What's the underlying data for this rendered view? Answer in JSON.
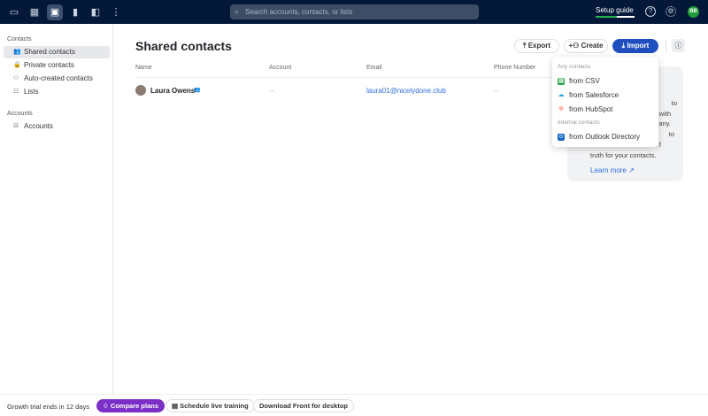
{
  "topbar": {
    "search_placeholder": "Search accounts, contacts, or lists",
    "setup_guide": "Setup guide",
    "setup_progress": 0.55,
    "avatar_initials": "BB"
  },
  "sidebar": {
    "contacts_header": "Contacts",
    "items": [
      {
        "label": "Shared contacts"
      },
      {
        "label": "Private contacts"
      },
      {
        "label": "Auto-created contacts"
      },
      {
        "label": "Lists"
      }
    ],
    "accounts_header": "Accounts",
    "accounts_item": "Accounts"
  },
  "main": {
    "title": "Shared contacts",
    "export": "Export",
    "create": "Create",
    "import": "Import",
    "columns": [
      "Name",
      "Account",
      "Email",
      "Phone Number"
    ],
    "rows": [
      {
        "name": "Laura Owens",
        "account": "--",
        "email": "laura01@nicelydone.club",
        "phone": "--"
      }
    ]
  },
  "info_card": {
    "fragments": [
      "to",
      "with",
      "any.",
      "to",
      "f"
    ],
    "last_line": "truth for your contacts.",
    "learn_more": "Learn more"
  },
  "import_menu": {
    "any_header": "Any contacts",
    "csv": "from CSV",
    "salesforce": "from Salesforce",
    "hubspot": "from HubSpot",
    "internal_header": "Internal contacts",
    "outlook": "from Outlook Directory"
  },
  "footer": {
    "trial": "Growth trial ends in 12 days",
    "compare": "Compare plans",
    "schedule": "Schedule live training",
    "download": "Download Front for desktop"
  }
}
